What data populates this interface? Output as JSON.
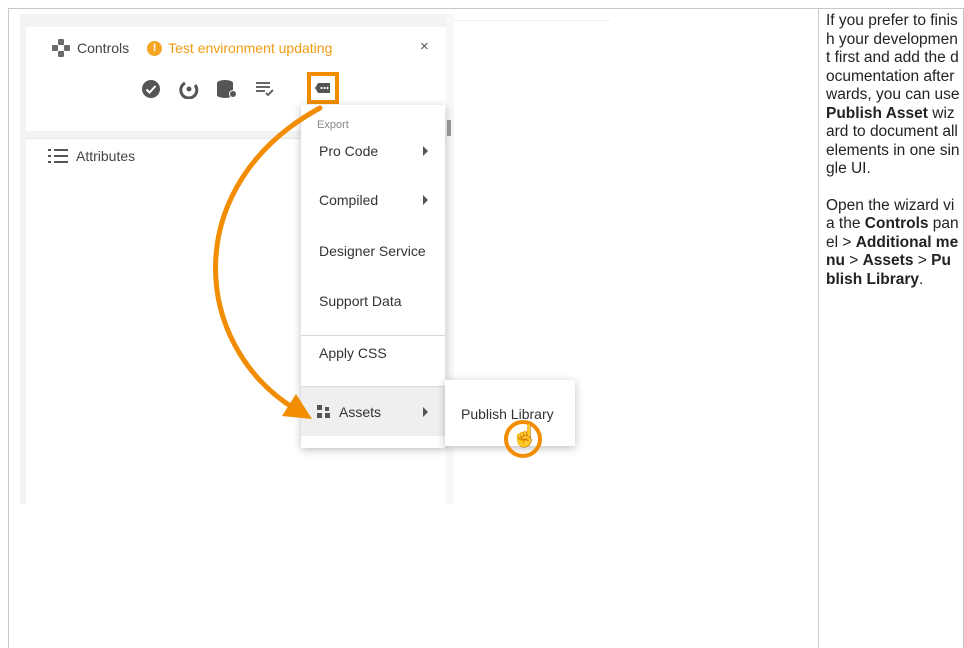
{
  "controls": {
    "title": "Controls",
    "warning_icon": "warning-icon",
    "warning_text": "Test environment updating",
    "close_label": "×",
    "toolbar_icons": [
      "check-circle-icon",
      "spinner-icon",
      "database-icon",
      "checklist-icon",
      "more-menu-icon"
    ]
  },
  "attributes": {
    "label": "Attributes"
  },
  "menu": {
    "section_label": "Export",
    "items": [
      {
        "label": "Pro Code",
        "has_submenu": true
      },
      {
        "label": "Compiled",
        "has_submenu": true
      },
      {
        "label": "Designer Service",
        "has_submenu": false
      },
      {
        "label": "Support Data",
        "has_submenu": false
      },
      {
        "label": "Apply CSS",
        "has_submenu": false
      },
      {
        "label": "Assets",
        "has_submenu": true
      }
    ]
  },
  "submenu": {
    "items": [
      {
        "label": "Publish Library"
      }
    ]
  },
  "annotation": {
    "accent_color": "#f28c00"
  },
  "note": {
    "p1_a": "If you prefer to finish your development first and add the documentation afterwards, you can use ",
    "p1_b": "Publish Asset",
    "p1_c": " wizard to document all elements in one single UI.",
    "p2_a": "Open the wizard via the ",
    "p2_b": "Controls",
    "p2_c": " panel > ",
    "p2_d": "Additional menu",
    "p2_e": " > ",
    "p2_f": "Assets",
    "p2_g": " > ",
    "p2_h": "Publish Library",
    "p2_i": "."
  }
}
